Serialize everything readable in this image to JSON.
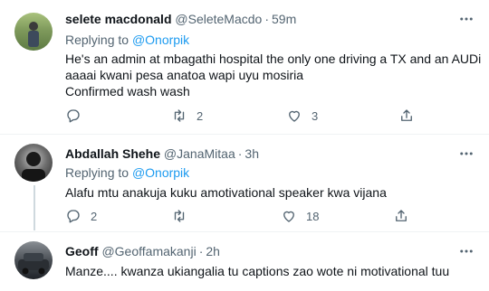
{
  "tweets": [
    {
      "name": "selete macdonald",
      "handle": "@SeleteMacdo",
      "time": "59m",
      "replying_prefix": "Replying to",
      "replying_to": "@Onorpik",
      "lines": [
        "He's an admin at mbagathi hospital the only one driving a TX and an AUDi",
        "aaaai kwani pesa anatoa wapi uyu mosiria",
        "Confirmed wash wash"
      ],
      "replies": "",
      "retweets": "2",
      "likes": "3"
    },
    {
      "name": "Abdallah Shehe",
      "handle": "@JanaMitaa",
      "time": "3h",
      "replying_prefix": "Replying to",
      "replying_to": "@Onorpik",
      "lines": [
        "Alafu mtu anakuja kuku amotivational speaker kwa vijana"
      ],
      "replies": "2",
      "retweets": "",
      "likes": "18"
    },
    {
      "name": "Geoff",
      "handle": "@Geoffamakanji",
      "time": "2h",
      "lines": [
        "Manze.... kwanza ukiangalia tu captions zao wote ni motivational tuu"
      ]
    }
  ],
  "separator": "·",
  "icons": {
    "more": "more-horizontal-icon",
    "reply": "reply-bubble-icon",
    "retweet": "retweet-icon",
    "like": "heart-icon",
    "share": "share-icon"
  },
  "colors": {
    "text": "#0f1419",
    "secondary": "#536471",
    "link": "#1d9bf0",
    "divider": "#eff3f4"
  }
}
